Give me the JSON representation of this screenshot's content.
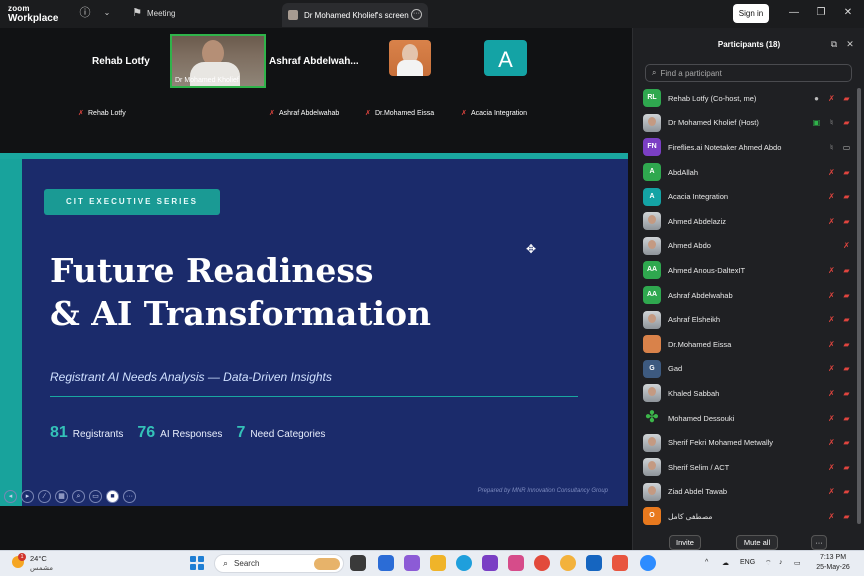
{
  "titlebar": {
    "logo_line1": "zoom",
    "logo_line2": "Workplace",
    "meeting_label": "Meeting",
    "screen_tab": "Dr Mohamed Kholief's screen",
    "signin": "Sign in"
  },
  "strip": {
    "tiles": [
      {
        "big_name": "Rehab Lotfy",
        "caption": "Rehab Lotfy"
      },
      {
        "caption": "Dr Mohamed Kholief"
      },
      {
        "big_name": "Ashraf  Abdelwah...",
        "caption": "Ashraf Abdelwahab"
      },
      {
        "caption": "Dr.Mohamed Eissa"
      },
      {
        "letter": "A",
        "caption": "Acacia Integration"
      }
    ]
  },
  "slide": {
    "series": "CIT EXECUTIVE SERIES",
    "title_line1": "Future Readiness",
    "title_line2": "& AI Transformation",
    "subtitle": "Registrant AI Needs Analysis — Data-Driven Insights",
    "stats": [
      {
        "num": "81",
        "label": "Registrants"
      },
      {
        "num": "76",
        "label": "AI Responses"
      },
      {
        "num": "7",
        "label": "Need Categories"
      }
    ],
    "prepared_by": "Prepared by MNR Innovation Consultancy Group",
    "colors": {
      "background": "#1b2b6b",
      "accent": "#1aa7a0"
    }
  },
  "panel": {
    "title": "Participants (18)",
    "search_placeholder": "Find a participant",
    "participants": [
      {
        "initials": "RL",
        "color": "#2fa84f",
        "name": "Rehab Lotfy (Co-host, me)"
      },
      {
        "initials": "",
        "color": "photo",
        "name": "Dr Mohamed Kholief (Host)"
      },
      {
        "initials": "FN",
        "color": "#7b3fc4",
        "name": "Fireflies.ai Notetaker Ahmed Abdo"
      },
      {
        "initials": "A",
        "color": "#2fa84f",
        "name": "AbdAllah"
      },
      {
        "initials": "A",
        "color": "#14a3a5",
        "name": "Acacia Integration"
      },
      {
        "initials": "",
        "color": "photo",
        "name": "Ahmed Abdelaziz"
      },
      {
        "initials": "",
        "color": "photo",
        "name": "Ahmed Abdo"
      },
      {
        "initials": "AA",
        "color": "#2fa84f",
        "name": "Ahmed Anous-DaltexIT"
      },
      {
        "initials": "AA",
        "color": "#2fa84f",
        "name": "Ashraf Abdelwahab"
      },
      {
        "initials": "",
        "color": "photo",
        "name": "Ashraf Elsheikh"
      },
      {
        "initials": "",
        "color": "#d9824a",
        "name": "Dr.Mohamed Eissa"
      },
      {
        "initials": "G",
        "color": "#3d5a80",
        "name": "Gad"
      },
      {
        "initials": "",
        "color": "photo",
        "name": "Khaled Sabbah"
      },
      {
        "initials": "",
        "color": "clover",
        "name": "Mohamed Dessouki"
      },
      {
        "initials": "",
        "color": "photo",
        "name": "Sherif Fekri Mohamed Metwally"
      },
      {
        "initials": "",
        "color": "photo",
        "name": "Sherif Selim / ACT"
      },
      {
        "initials": "",
        "color": "photo",
        "name": "Ziad Abdel Tawab"
      },
      {
        "initials": "O",
        "color": "#e8791e",
        "name": "مصطفى كامل"
      }
    ],
    "invite": "Invite",
    "mute_all": "Mute all",
    "more": "···"
  },
  "taskbar": {
    "temp": "24°C",
    "condition": "مشمس",
    "weather_badge": "1",
    "search_label": "Search",
    "lang": "ENG",
    "time": "7:13 PM",
    "date": "25-May-26"
  }
}
